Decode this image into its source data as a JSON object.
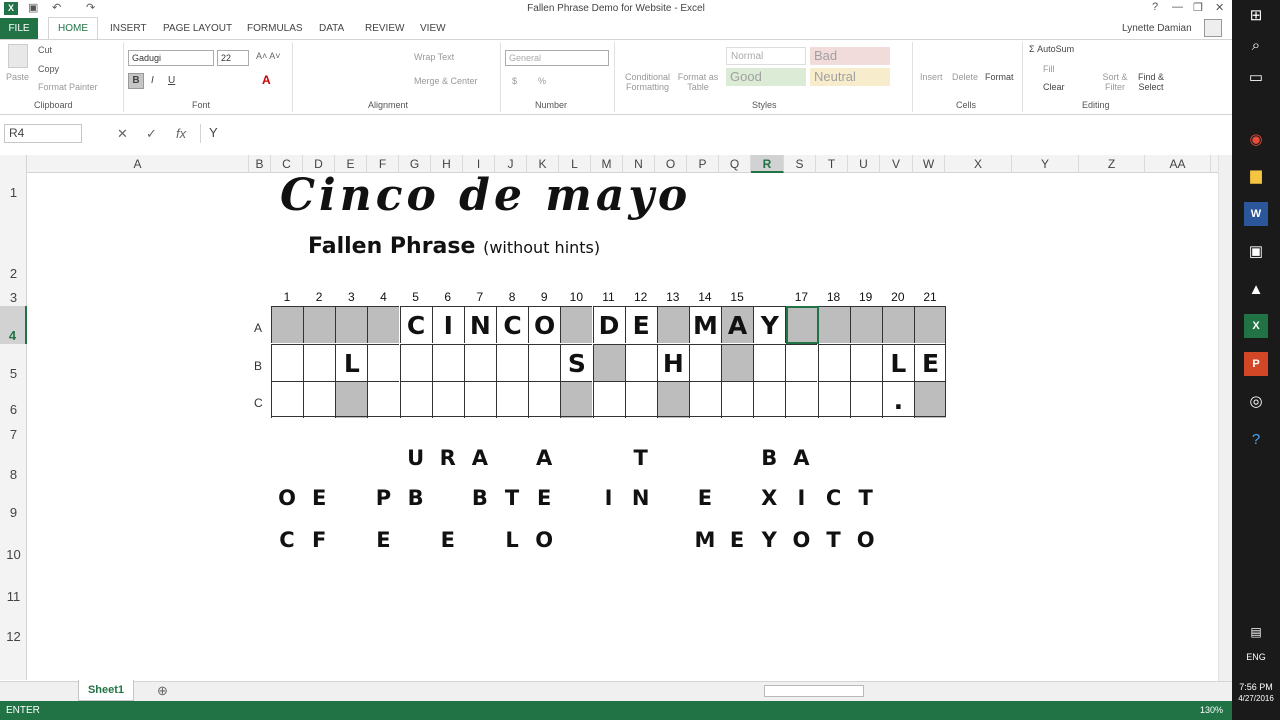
{
  "window": {
    "title": "Fallen Phrase Demo for Website - Excel",
    "user": "Lynette Damian"
  },
  "tabs": [
    "FILE",
    "HOME",
    "INSERT",
    "PAGE LAYOUT",
    "FORMULAS",
    "DATA",
    "REVIEW",
    "VIEW"
  ],
  "clipboard": {
    "paste": "Paste",
    "cut": "Cut",
    "copy": "Copy",
    "format_painter": "Format Painter",
    "label": "Clipboard"
  },
  "font": {
    "name": "Gadugi",
    "size": "22",
    "label": "Font",
    "bold": "B",
    "italic": "I",
    "underline": "U"
  },
  "alignment": {
    "wrap": "Wrap Text",
    "merge": "Merge & Center",
    "label": "Alignment"
  },
  "number": {
    "format": "General",
    "label": "Number",
    "currency": "$",
    "percent": "%"
  },
  "styles": {
    "conditional": "Conditional Formatting",
    "format_as_table": "Format as Table",
    "normal": "Normal",
    "bad": "Bad",
    "good": "Good",
    "neutral": "Neutral",
    "label": "Styles"
  },
  "cells": {
    "insert": "Insert",
    "delete": "Delete",
    "format": "Format",
    "label": "Cells"
  },
  "editing": {
    "autosum": "AutoSum",
    "fill": "Fill",
    "clear": "Clear",
    "sort": "Sort & Filter",
    "find": "Find & Select",
    "label": "Editing"
  },
  "formula": {
    "namebox": "R4",
    "content": "Y"
  },
  "columns": [
    "A",
    "B",
    "C",
    "D",
    "E",
    "F",
    "G",
    "H",
    "I",
    "J",
    "K",
    "L",
    "M",
    "N",
    "O",
    "P",
    "Q",
    "R",
    "S",
    "T",
    "U",
    "V",
    "W",
    "X",
    "Y",
    "Z",
    "AA"
  ],
  "rows": [
    "1",
    "2",
    "3",
    "4",
    "5",
    "6",
    "7",
    "8",
    "9",
    "10",
    "11",
    "12"
  ],
  "puzzle": {
    "title": "Cinco de mayo",
    "subtitle": "Fallen Phrase",
    "subtitle_note": "(without hints)",
    "numbers": [
      "1",
      "2",
      "3",
      "4",
      "5",
      "6",
      "7",
      "8",
      "9",
      "10",
      "11",
      "12",
      "13",
      "14",
      "15",
      "",
      "17",
      "18",
      "19",
      "20",
      "21"
    ],
    "row_labels": [
      "A",
      "B",
      "C"
    ],
    "row_a": [
      "",
      "",
      "",
      "",
      "C",
      "I",
      "N",
      "C",
      "O",
      "",
      "D",
      "E",
      "",
      "M",
      "A",
      "Y",
      "",
      "",
      "",
      "",
      ""
    ],
    "row_b": [
      "",
      "",
      "L",
      "",
      "",
      "",
      "",
      "",
      "",
      "S",
      "",
      "",
      "H",
      "",
      "",
      "",
      "",
      "",
      "",
      "L",
      "E"
    ],
    "row_c": [
      "",
      "",
      "",
      "",
      "",
      "",
      "",
      "",
      "",
      "",
      "",
      "",
      "",
      "",
      "",
      "",
      "",
      "",
      "",
      ".",
      ""
    ],
    "loose_row_8": [
      "",
      "",
      "",
      "",
      "U",
      "R",
      "A",
      "",
      "A",
      "",
      "",
      "T",
      "",
      "",
      "",
      "B",
      "A",
      "",
      "",
      "",
      ""
    ],
    "loose_row_9": [
      "O",
      "E",
      "",
      "P",
      "B",
      "",
      "B",
      "T",
      "E",
      "",
      "I",
      "N",
      "",
      "E",
      "",
      "X",
      "I",
      "C",
      "T",
      "",
      ""
    ],
    "loose_row_10": [
      "C",
      "F",
      "",
      "E",
      "",
      "E",
      "",
      "L",
      "O",
      "",
      "",
      "",
      "",
      "M",
      "E",
      "Y",
      "O",
      "T",
      "O",
      "",
      ""
    ]
  },
  "sheet_tab": "Sheet1",
  "status": "ENTER",
  "zoom": "130%",
  "clock": {
    "time": "7:56 PM",
    "date": "4/27/2016"
  },
  "lang": "ENG"
}
